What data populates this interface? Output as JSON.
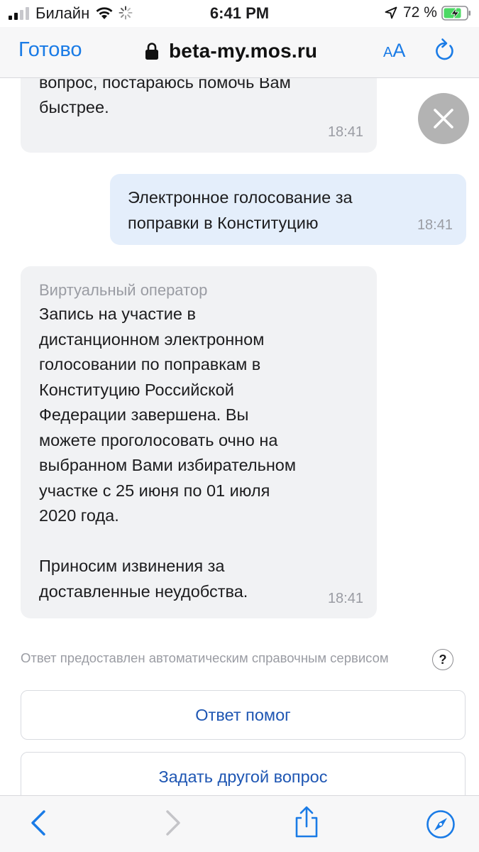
{
  "status_bar": {
    "carrier": "Билайн",
    "time": "6:41 PM",
    "battery_percent": "72 %",
    "icons": [
      "signal-icon",
      "wifi-icon",
      "activity-spinner-icon",
      "location-arrow-icon",
      "battery-charging-icon"
    ]
  },
  "browser": {
    "done_label": "Готово",
    "url": "beta-my.mos.ru",
    "text_size_small": "A",
    "text_size_big": "A",
    "icons": [
      "lock-icon",
      "reload-icon"
    ]
  },
  "chat": {
    "messages": [
      {
        "from": "operator",
        "text": "вопросы или задать другой\nвопрос, постараюсь помочь Вам\nбыстрее.",
        "time": "18:41"
      },
      {
        "from": "user",
        "text": "Электронное голосование за\nпоправки в Конституцию",
        "time": "18:41"
      },
      {
        "from": "operator",
        "sender": "Виртуальный оператор",
        "text": "Запись на участие в\nдистанционном электронном\nголосовании по поправкам в\nКонституцию Российской\nФедерации завершена. Вы\nможете проголосовать очно на\nвыбранном Вами избирательном\nучастке с 25 июня по 01 июля\n2020 года.\n\nПриносим извинения за\nдоставленные неудобства.",
        "time": "18:41"
      }
    ],
    "note": "Ответ предоставлен автоматическим справочным сервисом",
    "help_label": "?",
    "buttons": {
      "helped": "Ответ помог",
      "ask_another": "Задать другой вопрос"
    }
  },
  "toolbar": {
    "icons": [
      "back-icon",
      "forward-icon",
      "share-icon",
      "compass-icon"
    ]
  },
  "colors": {
    "accent": "#1a7be6",
    "button_text": "#1e56b3",
    "operator_bubble": "#f1f2f4",
    "user_bubble": "#e4eefb",
    "muted_text": "#9a9ca3"
  }
}
